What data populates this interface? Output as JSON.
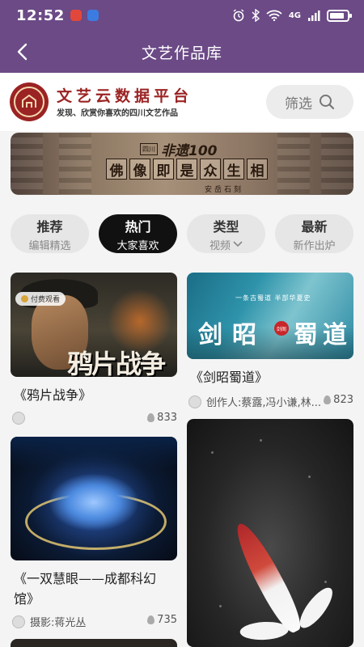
{
  "status_bar": {
    "time": "12:52",
    "network": "4G",
    "battery_level": 0.85
  },
  "header": {
    "title": "文艺作品库"
  },
  "brand": {
    "name": "文艺云数据平台",
    "slogan": "发现、欣赏你喜欢的四川文艺作品",
    "filter_label": "筛选"
  },
  "banner": {
    "badge_tag": "四川",
    "badge_big": "非遗100",
    "main_text": [
      "佛",
      "像",
      "即",
      "是",
      "众",
      "生",
      "相"
    ],
    "sub_text": "安岳石刻"
  },
  "tabs": [
    {
      "title": "推荐",
      "subtitle": "编辑精选",
      "active": false
    },
    {
      "title": "热门",
      "subtitle": "大家喜欢",
      "active": true
    },
    {
      "title": "类型",
      "subtitle": "视频",
      "active": false,
      "dropdown": true
    },
    {
      "title": "最新",
      "subtitle": "新作出炉",
      "active": false
    }
  ],
  "cards": [
    {
      "title": "《鸦片战争》",
      "author": "",
      "likes": "833",
      "badge": "付费观看",
      "image_text": "鸦片战争"
    },
    {
      "title": "《剑昭蜀道》",
      "author": "创作人:蔡露,冯小谦,林...",
      "likes": "823",
      "image_small_text": "一条古蜀道 半部华夏史",
      "image_chars": [
        "剑",
        "昭",
        "蜀",
        "道"
      ],
      "seal_text": "剑阁"
    },
    {
      "title": "《一双慧眼——成都科幻馆》",
      "title_line1": "《一双慧眼——成都科幻",
      "title_line2": "馆》",
      "author": "摄影:蒋光丛",
      "likes": "735"
    },
    {
      "title": ""
    }
  ],
  "colors": {
    "header_bg": "#6b4a86",
    "brand_red": "#9b2323",
    "active_tab": "#111111"
  },
  "icons": {
    "back": "chevron-left-icon",
    "filter": "search-icon",
    "likes": "flame-icon"
  }
}
